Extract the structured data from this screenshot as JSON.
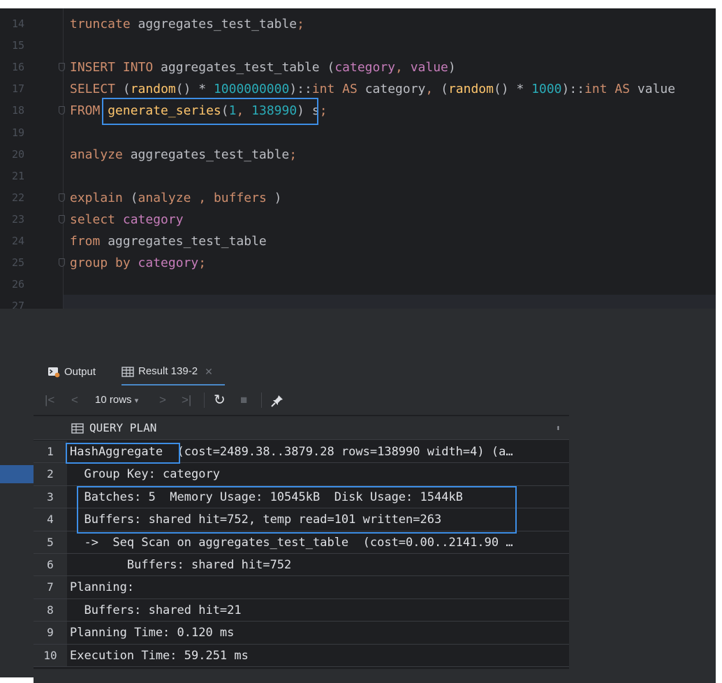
{
  "editor": {
    "lines": [
      {
        "num": "14",
        "html": "<span class='kw'>truncate</span> aggregates_test_table<span class='kw'>;</span>"
      },
      {
        "num": "15",
        "html": ""
      },
      {
        "num": "16",
        "html": "<span class='kw'>INSERT INTO</span> aggregates_test_table (<span class='nm'>category</span><span class='kw'>,</span> <span class='nm'>value</span>)"
      },
      {
        "num": "17",
        "html": "<span class='kw'>SELECT</span> (<span class='fn'>random</span>() * <span class='num'>1000000000</span>)::<span class='kw'>int AS</span> category<span class='kw'>,</span> (<span class='fn'>random</span>() * <span class='num'>1000</span>)::<span class='kw'>int AS</span> value"
      },
      {
        "num": "18",
        "html": "<span class='kw'>FROM</span> <span class='fn'>generate_series</span>(<span class='num'>1</span><span class='kw'>,</span> <span class='num'>138990</span>) s<span class='kw'>;</span>"
      },
      {
        "num": "19",
        "html": ""
      },
      {
        "num": "20",
        "html": "<span class='kw'>analyze</span> aggregates_test_table<span class='kw'>;</span>"
      },
      {
        "num": "21",
        "html": ""
      },
      {
        "num": "22",
        "html": "<span class='kw'>explain</span> (<span class='kw'>analyze</span> <span class='kw'>,</span> <span class='kw'>buffers</span> )"
      },
      {
        "num": "23",
        "html": "<span class='kw'>select</span> <span class='nm'>category</span>"
      },
      {
        "num": "24",
        "html": "<span class='kw'>from</span> aggregates_test_table"
      },
      {
        "num": "25",
        "html": "<span class='kw'>group by</span> <span class='nm'>category</span><span class='kw'>;</span>"
      },
      {
        "num": "26",
        "html": ""
      },
      {
        "num": "27",
        "html": ""
      }
    ]
  },
  "tabs": {
    "output_label": "Output",
    "result_label": "Result 139-2"
  },
  "toolbar": {
    "rows_label": "10 rows"
  },
  "grid": {
    "header": "QUERY PLAN",
    "rows": [
      {
        "n": "1",
        "text": "HashAggregate  (cost=2489.38..3879.28 rows=138990 width=4) (a…"
      },
      {
        "n": "2",
        "text": "  Group Key: category"
      },
      {
        "n": "3",
        "text": "  Batches: 5  Memory Usage: 10545kB  Disk Usage: 1544kB"
      },
      {
        "n": "4",
        "text": "  Buffers: shared hit=752, temp read=101 written=263"
      },
      {
        "n": "5",
        "text": "  ->  Seq Scan on aggregates_test_table  (cost=0.00..2141.90 …"
      },
      {
        "n": "6",
        "text": "        Buffers: shared hit=752"
      },
      {
        "n": "7",
        "text": "Planning:"
      },
      {
        "n": "8",
        "text": "  Buffers: shared hit=21"
      },
      {
        "n": "9",
        "text": "Planning Time: 0.120 ms"
      },
      {
        "n": "10",
        "text": "Execution Time: 59.251 ms"
      }
    ]
  },
  "colors": {
    "highlight_border": "#3d8ee6",
    "editor_bg": "#1e1f22",
    "panel_bg": "#2b2d30",
    "keyword": "#cf8e6d",
    "function": "#ffc66d",
    "number": "#2aacb8",
    "identifier": "#c77dbb"
  }
}
